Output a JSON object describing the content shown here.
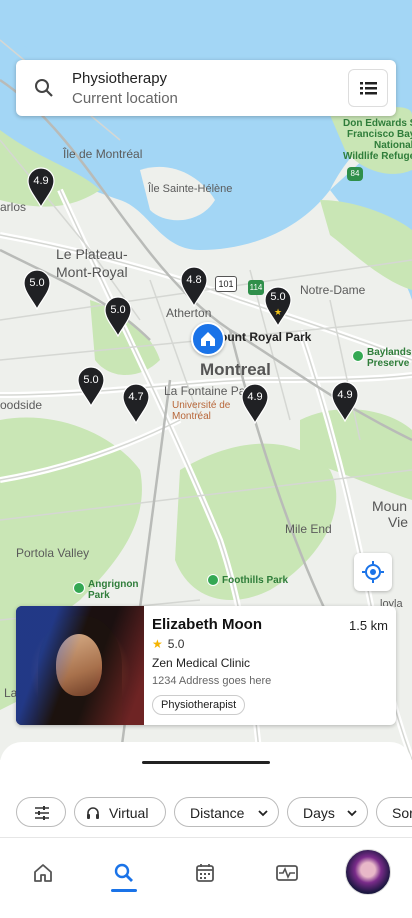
{
  "map": {
    "labels": {
      "ile_de_montreal": "Île de Montréal",
      "ile_sainte_helene": "Île Sainte-Hélène",
      "plateau": "Le Plateau-\nMont-Royal",
      "le_plateau": "Le Plateau-",
      "mont_royal": "Mont-Royal",
      "atherton": "Atherton",
      "mount_royal_park": "Mount Royal Park",
      "montreal": "Montreal",
      "la_fontaine_park": "La Fontaine Park",
      "universite_1": "Université de",
      "universite_2": "Montréal",
      "notre_dame": "Notre-Dame",
      "baylands_1": "Baylands",
      "baylands_2": "Preserve",
      "don_edwards_1": "Don Edwards Sa",
      "don_edwards_2": "Francisco Bay",
      "don_edwards_3": "National",
      "don_edwards_4": "Wildlife Refuge",
      "portola_valley": "Portola Valley",
      "angrignon_1": "Angrignon",
      "angrignon_2": "Park",
      "foothills_park": "Foothills Park",
      "mile_end": "Mile End",
      "mount_view_1": "Moun",
      "mount_view_2": "Vie",
      "carlos": "arlos",
      "woodside": "oodside",
      "la": "La",
      "ioyla": "loyla",
      "route_101": "101",
      "route_114": "114",
      "route_84": "84"
    },
    "pins": [
      {
        "value": "4.9",
        "starred": false
      },
      {
        "value": "5.0",
        "starred": false
      },
      {
        "value": "5.0",
        "starred": false
      },
      {
        "value": "4.8",
        "starred": false
      },
      {
        "value": "5.0",
        "starred": true
      },
      {
        "value": "5.0",
        "starred": false
      },
      {
        "value": "4.7",
        "starred": false
      },
      {
        "value": "4.9",
        "starred": false
      },
      {
        "value": "4.9",
        "starred": false
      }
    ]
  },
  "search": {
    "query": "Physiotherapy",
    "location": "Current location"
  },
  "card": {
    "name": "Elizabeth Moon",
    "distance": "1.5 km",
    "rating": "5.0",
    "clinic": "Zen Medical Clinic",
    "address": "1234 Address goes here",
    "tag": "Physiotherapist"
  },
  "filters": {
    "virtual": "Virtual",
    "distance": "Distance",
    "days": "Days",
    "sort": "Sor"
  },
  "colors": {
    "accent": "#1a73e8",
    "water": "#a3d6f5",
    "park": "#c9e6b5",
    "pin": "#202124",
    "star": "#f5b400"
  },
  "icons": [
    "search-icon",
    "list-icon",
    "my-location-icon",
    "filter-sliders-icon",
    "virtual-headset-icon",
    "chevron-down-icon",
    "home-icon",
    "calendar-icon",
    "activity-icon",
    "user-avatar"
  ]
}
